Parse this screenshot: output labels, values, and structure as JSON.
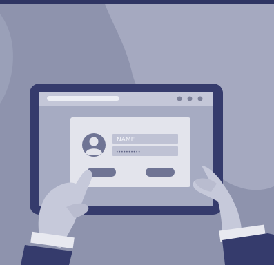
{
  "login_card": {
    "name_label": "NAME",
    "password_mask": "••••••••••"
  },
  "colors": {
    "background": "#8e93ad",
    "background_blob": "#a8acc2",
    "top_bar": "#2f3563",
    "tablet_frame": "#353b6c",
    "screen": "#a6abc2",
    "browser_bar": "#c4c7d8",
    "card": "#e3e4ec",
    "field": "#bfc2d4",
    "avatar": "#6f7494",
    "hand": "#c6c9da",
    "sleeve": "#353b6c",
    "cuff": "#e8e9f0"
  },
  "icons": [
    "user-avatar-icon",
    "browser-window-dots"
  ]
}
